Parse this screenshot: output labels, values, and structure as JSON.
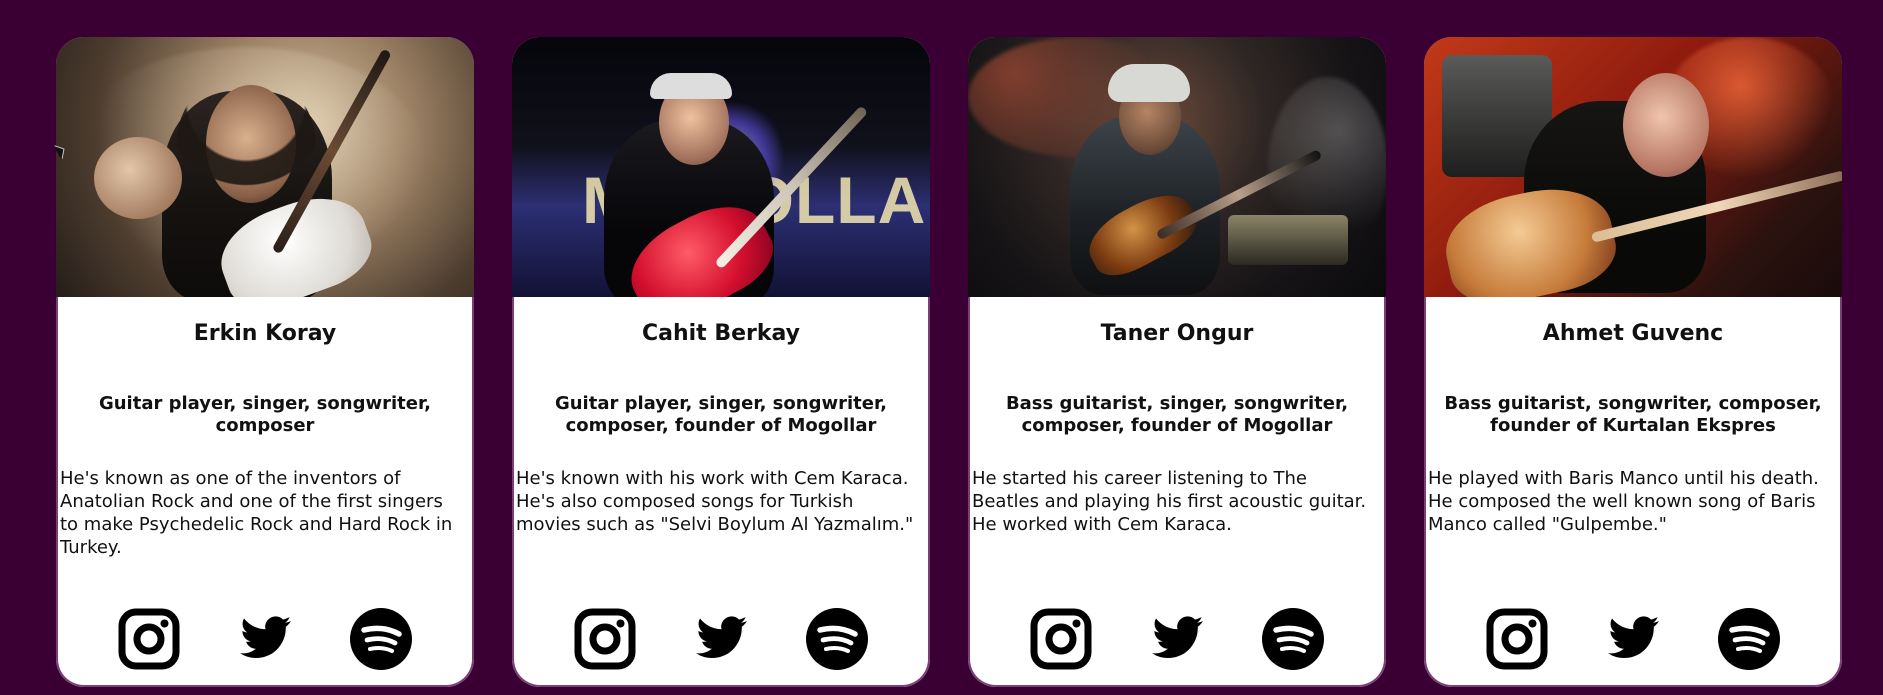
{
  "cards": [
    {
      "name": "Erkin Koray",
      "role": "Guitar player, singer, songwriter, composer",
      "bio": "He's known as one of the inventors of Anatolian Rock and one of the first singers to make Psychedelic Rock and Hard Rock in Turkey.",
      "photo_alt": "Erkin Koray photo",
      "icons": [
        "instagram-icon",
        "twitter-icon",
        "spotify-icon"
      ]
    },
    {
      "name": "Cahit Berkay",
      "role": "Guitar player, singer, songwriter, composer, founder of Mogollar",
      "bio": "He's known with his work with Cem Karaca. He's also composed songs for Turkish movies such as \"Selvi Boylum Al Yazmalım.\"",
      "photo_alt": "Cahit Berkay photo",
      "stage_text": "MOGOLLAR",
      "icons": [
        "instagram-icon",
        "twitter-icon",
        "spotify-icon"
      ]
    },
    {
      "name": "Taner Ongur",
      "role": "Bass guitarist, singer, songwriter, composer, founder of Mogollar",
      "bio": "He started his career listening to The Beatles and playing his first acoustic guitar. He worked with Cem Karaca.",
      "photo_alt": "Taner Ongur photo",
      "icons": [
        "instagram-icon",
        "twitter-icon",
        "spotify-icon"
      ]
    },
    {
      "name": "Ahmet Guvenc",
      "role": "Bass guitarist, songwriter, composer, founder of Kurtalan Ekspres",
      "bio": "He played with Baris Manco until his death. He composed the well known song of Baris Manco called \"Gulpembe.\"",
      "photo_alt": "Ahmet Guvenc photo",
      "icons": [
        "instagram-icon",
        "twitter-icon",
        "spotify-icon"
      ]
    }
  ],
  "colors": {
    "page_background": "#3a0033",
    "card_background": "#ffffff",
    "text": "#111111",
    "icon": "#000000"
  }
}
